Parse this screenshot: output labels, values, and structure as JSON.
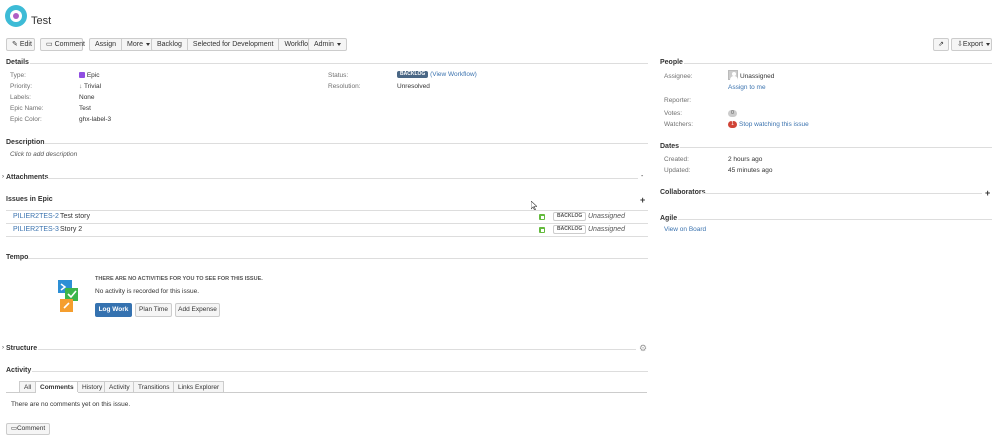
{
  "header": {
    "title": "Test"
  },
  "toolbar": {
    "edit": "Edit",
    "comment": "Comment",
    "assign": "Assign",
    "more": "More",
    "backlog": "Backlog",
    "selected_for_dev": "Selected for Development",
    "workflow": "Workflow",
    "admin": "Admin",
    "export": "Export"
  },
  "details": {
    "heading": "Details",
    "type_label": "Type:",
    "type_value": "Epic",
    "priority_label": "Priority:",
    "priority_value": "Trivial",
    "labels_label": "Labels:",
    "labels_value": "None",
    "epic_name_label": "Epic Name:",
    "epic_name_value": "Test",
    "epic_color_label": "Epic Color:",
    "epic_color_value": "ghx-label-3",
    "status_label": "Status:",
    "status_value": "BACKLOG",
    "view_workflow": "(View Workflow)",
    "resolution_label": "Resolution:",
    "resolution_value": "Unresolved"
  },
  "description": {
    "heading": "Description",
    "placeholder": "Click to add description"
  },
  "attachments": {
    "heading": "Attachments"
  },
  "issues_in_epic": {
    "heading": "Issues in Epic",
    "rows": [
      {
        "key": "PILIER2TES-2",
        "summary": "Test story",
        "status": "BACKLOG",
        "assignee": "Unassigned"
      },
      {
        "key": "PILIER2TES-3",
        "summary": "Story 2",
        "status": "BACKLOG",
        "assignee": "Unassigned"
      }
    ]
  },
  "tempo": {
    "heading": "Tempo",
    "title": "THERE ARE NO ACTIVITIES FOR YOU TO SEE FOR THIS ISSUE.",
    "message": "No activity is recorded for this issue.",
    "log_work": "Log Work",
    "plan_time": "Plan Time",
    "add_expense": "Add Expense"
  },
  "structure": {
    "heading": "Structure"
  },
  "activity": {
    "heading": "Activity",
    "tabs": [
      "All",
      "Comments",
      "History",
      "Activity",
      "Transitions",
      "Links Explorer"
    ],
    "active_tab": "Comments",
    "empty": "There are no comments yet on this issue.",
    "comment_button": "Comment"
  },
  "people": {
    "heading": "People",
    "assignee_label": "Assignee:",
    "assignee_value": "Unassigned",
    "assign_to_me": "Assign to me",
    "reporter_label": "Reporter:",
    "votes_label": "Votes:",
    "votes_value": "0",
    "watchers_label": "Watchers:",
    "watchers_value": "1",
    "stop_watching": "Stop watching this issue"
  },
  "dates": {
    "heading": "Dates",
    "created_label": "Created:",
    "created_value": "2 hours ago",
    "updated_label": "Updated:",
    "updated_value": "45 minutes ago"
  },
  "collaborators": {
    "heading": "Collaborators"
  },
  "agile": {
    "heading": "Agile",
    "view_on_board": "View on Board"
  },
  "colors": {
    "link": "#3b73af",
    "primary": "#3572b0",
    "lozenge": "#4a6785",
    "story": "#63ba3c",
    "epic": "#904ee2",
    "watch": "#d04437"
  }
}
